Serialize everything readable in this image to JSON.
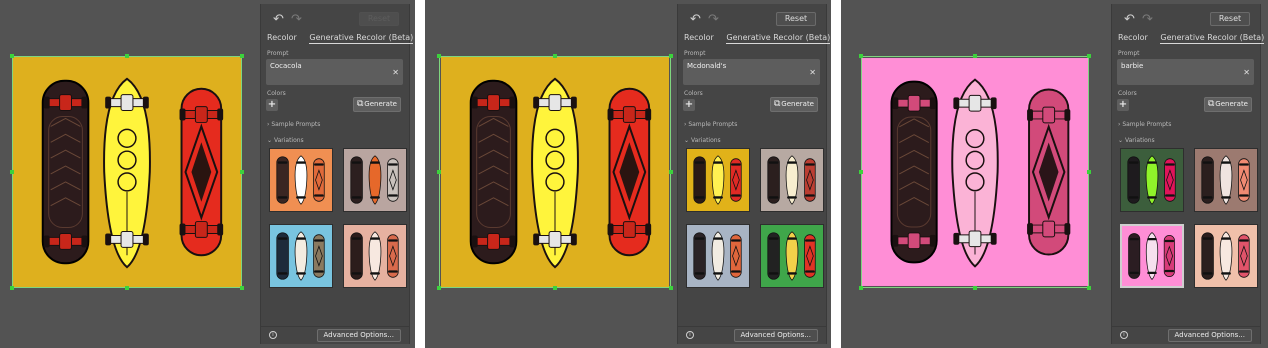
{
  "labels": {
    "reset": "Reset",
    "tab_recolor": "Recolor",
    "tab_generative": "Generative Recolor (Beta)",
    "prompt_label": "Prompt",
    "colors_label": "Colors",
    "generate": "Generate",
    "sample_prompts": "Sample Prompts",
    "variations": "Variations",
    "advanced_options": "Advanced Options..."
  },
  "screenshots": [
    {
      "prompt_value": "Cocacola",
      "reset_enabled": false,
      "artboard_bg": "#deb01e",
      "boards": {
        "long": [
          "#2c1b1c",
          "#161010"
        ],
        "pin": [
          "#fff43c",
          "#2a1c16"
        ],
        "deck": [
          "#e52b1e",
          "#2a1410"
        ],
        "truck": "#c8261a"
      },
      "variations": [
        {
          "bg": "#f08f52",
          "c": [
            "#3a2622",
            "#ffffff",
            "#e06a3a"
          ]
        },
        {
          "bg": "#b9a5a0",
          "c": [
            "#2c1f1f",
            "#e6682a",
            "#c9c1bc"
          ]
        },
        {
          "bg": "#79c4df",
          "c": [
            "#1e2b3a",
            "#f3ece0",
            "#8a7a60"
          ]
        },
        {
          "bg": "#e6b1a0",
          "c": [
            "#2c1d1c",
            "#f7e8e0",
            "#d96a4c"
          ]
        }
      ]
    },
    {
      "prompt_value": "Mcdonald's",
      "reset_enabled": true,
      "artboard_bg": "#deb01e",
      "boards": {
        "long": [
          "#2c1b1c",
          "#161010"
        ],
        "pin": [
          "#fff43c",
          "#2a1c16"
        ],
        "deck": [
          "#e52b1e",
          "#2a1410"
        ],
        "truck": "#c8261a"
      },
      "variations": [
        {
          "bg": "#e1b219",
          "c": [
            "#2a1a16",
            "#fff152",
            "#df2a25"
          ]
        },
        {
          "bg": "#b7a9a2",
          "c": [
            "#2b1f1e",
            "#f7edcf",
            "#bb3e32"
          ]
        },
        {
          "bg": "#a8b4c4",
          "c": [
            "#2b2326",
            "#f1ece2",
            "#e0663c"
          ]
        },
        {
          "bg": "#3fa64a",
          "c": [
            "#222222",
            "#f2d14a",
            "#e03325"
          ]
        }
      ]
    },
    {
      "prompt_value": "barbie",
      "reset_enabled": true,
      "artboard_bg": "#ff8ed6",
      "boards": {
        "long": [
          "#2c1b1c",
          "#161010"
        ],
        "pin": [
          "#fbb3d6",
          "#2a1c16"
        ],
        "deck": [
          "#d24a7a",
          "#2a1418"
        ],
        "truck": "#d24a7a"
      },
      "variations": [
        {
          "bg": "#3c5e3c",
          "c": [
            "#1e1b1e",
            "#8ff32a",
            "#e0145a"
          ]
        },
        {
          "bg": "#9c7a70",
          "c": [
            "#2b1f1e",
            "#f0e4e0",
            "#f08a72"
          ]
        },
        {
          "bg": "#ff8ed6",
          "c": [
            "#2b1d22",
            "#f6e0ee",
            "#d83a7a"
          ]
        },
        {
          "bg": "#f0c0aa",
          "c": [
            "#2b1f1e",
            "#f7e8e0",
            "#e0546a"
          ]
        }
      ]
    }
  ]
}
